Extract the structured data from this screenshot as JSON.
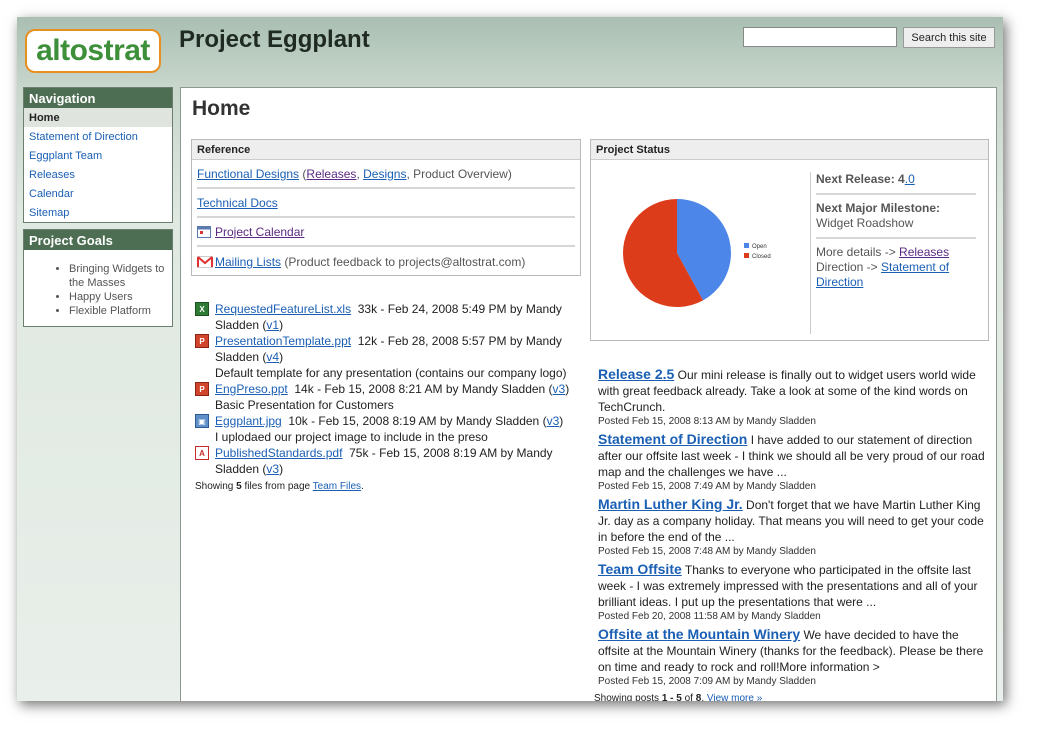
{
  "header": {
    "logo_text": "altostrat",
    "site_title": "Project Eggplant",
    "search_button": "Search this site"
  },
  "nav": {
    "title": "Navigation",
    "items": [
      {
        "label": "Home"
      },
      {
        "label": "Statement of Direction"
      },
      {
        "label": "Eggplant Team"
      },
      {
        "label": "Releases"
      },
      {
        "label": "Calendar"
      },
      {
        "label": "Sitemap"
      }
    ]
  },
  "goals": {
    "title": "Project Goals",
    "items": [
      "Bringing Widgets to the Masses",
      "Happy Users",
      "Flexible Platform"
    ]
  },
  "page": {
    "title": "Home"
  },
  "reference": {
    "title": "Reference",
    "functional_designs": "Functional Designs",
    "open_paren": " (",
    "releases": "Releases",
    "comma1": ", ",
    "designs": "Designs",
    "product_overview": ", Product Overview)",
    "technical_docs": "Technical Docs",
    "project_calendar": "Project Calendar ",
    "mailing_lists": "Mailing Lists ",
    "mailing_note": " (Product feedback to projects@altostrat.com)"
  },
  "files": [
    {
      "name": "RequestedFeatureList.xls",
      "info": "  33k - Feb 24, 2008 5:49 PM by Mandy Sladden (",
      "version": "v1",
      "close": ")",
      "desc": "",
      "type": "xls"
    },
    {
      "name": "PresentationTemplate.ppt",
      "info": "  12k - Feb 28, 2008 5:57 PM by Mandy Sladden (",
      "version": "v4",
      "close": ")",
      "desc": "Default template for any presentation (contains our company logo)",
      "type": "ppt"
    },
    {
      "name": "EngPreso.ppt",
      "info": "  14k - Feb 15, 2008 8:21 AM by Mandy Sladden (",
      "version": "v3",
      "close": ")",
      "desc": "Basic Presentation for Customers",
      "type": "ppt"
    },
    {
      "name": "Eggplant.jpg",
      "info": "  10k - Feb 15, 2008 8:19 AM by Mandy Sladden (",
      "version": "v3",
      "close": ")",
      "desc": "I uplodaed our project image to include in the preso",
      "type": "jpg"
    },
    {
      "name": "PublishedStandards.pdf",
      "info": "  75k - Feb 15, 2008 8:19 AM by Mandy Sladden (",
      "version": "v3",
      "close": ")",
      "desc": "",
      "type": "pdf"
    }
  ],
  "files_footer": {
    "prefix": "Showing ",
    "count": "5",
    "middle": " files from page ",
    "link": "Team Files",
    "suffix": "."
  },
  "status": {
    "title": "Project Status",
    "next_release_label": "Next Release:",
    "next_release_major": " 4",
    "next_release_minor": ".0",
    "milestone_label": "Next Major Milestone:",
    "milestone_value": "Widget Roadshow",
    "more_details": "More details -> ",
    "releases_link": "Releases",
    "direction_text": "Direction -> ",
    "direction_link": "Statement of Direction"
  },
  "chart_data": {
    "type": "pie",
    "labels": [
      "Open",
      "Closed"
    ],
    "values": [
      42,
      58
    ],
    "colors": [
      "#4c86e8",
      "#dd3c1a"
    ],
    "legend": "right"
  },
  "posts": [
    {
      "title": "Release 2.5",
      "body": " Our mini release is finally out to widget users world wide with great feedback already. Take a look at some of the kind words on TechCrunch.",
      "meta": "Posted Feb 15, 2008 8:13 AM by Mandy Sladden"
    },
    {
      "title": "Statement of Direction",
      "body": " I have added to our statement of direction after our offsite last week - I think we should all be very proud of our road map and the challenges we have ...",
      "meta": "Posted Feb 15, 2008 7:49 AM by Mandy Sladden"
    },
    {
      "title": "Martin Luther King Jr.",
      "body": " Don't forget that we have Martin Luther King Jr. day as a company holiday. That means you will need to get your code in before the end of the ...",
      "meta": "Posted Feb 15, 2008 7:48 AM by Mandy Sladden"
    },
    {
      "title": "Team Offsite",
      "body": " Thanks to everyone who participated in the offsite last week - I was extremely impressed with the presentations and all of your brilliant ideas. I put up the presentations that were ...",
      "meta": "Posted Feb 20, 2008 11:58 AM by Mandy Sladden"
    },
    {
      "title": "Offsite at the Mountain Winery",
      "body": " We have decided to have the offsite at the Mountain Winery (thanks for the feedback). Please be there on time and ready to rock and roll!More information >",
      "meta": "Posted Feb 15, 2008 7:09 AM by Mandy Sladden"
    }
  ],
  "posts_footer": {
    "prefix": "Showing posts ",
    "range": "1 - 5",
    "middle": " of ",
    "total": "8",
    "period": ". ",
    "view_more": "View more »"
  }
}
